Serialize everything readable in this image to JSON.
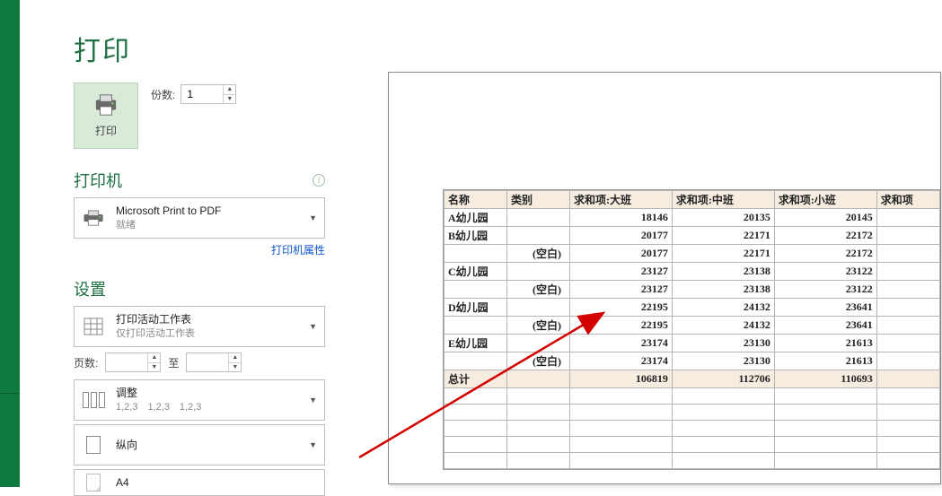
{
  "title": "打印",
  "printBtn": {
    "label": "打印"
  },
  "copies": {
    "label": "份数:",
    "value": "1"
  },
  "printerSection": {
    "title": "打印机",
    "name": "Microsoft Print to PDF",
    "status": "就绪",
    "propertiesLink": "打印机属性"
  },
  "settingsSection": {
    "title": "设置",
    "scope": {
      "line1": "打印活动工作表",
      "line2": "仅打印活动工作表"
    },
    "pages": {
      "label": "页数:",
      "to": "至"
    },
    "collate": {
      "line1": "调整",
      "line2": "1,2,3　1,2,3　1,2,3"
    },
    "orientation": {
      "line1": "纵向"
    },
    "paper": {
      "line1": "A4"
    }
  },
  "chart_data": {
    "type": "table",
    "columns": [
      "名称",
      "类别",
      "求和项:大班",
      "求和项:中班",
      "求和项:小班",
      "求和项"
    ],
    "rows": [
      [
        "A幼儿园",
        "",
        18146,
        20135,
        20145,
        null
      ],
      [
        "B幼儿园",
        "",
        20177,
        22171,
        22172,
        null
      ],
      [
        "",
        "(空白)",
        20177,
        22171,
        22172,
        null
      ],
      [
        "C幼儿园",
        "",
        23127,
        23138,
        23122,
        null
      ],
      [
        "",
        "(空白)",
        23127,
        23138,
        23122,
        null
      ],
      [
        "D幼儿园",
        "",
        22195,
        24132,
        23641,
        null
      ],
      [
        "",
        "(空白)",
        22195,
        24132,
        23641,
        null
      ],
      [
        "E幼儿园",
        "",
        23174,
        23130,
        21613,
        null
      ],
      [
        "",
        "(空白)",
        23174,
        23130,
        21613,
        null
      ]
    ],
    "totalRow": [
      "总计",
      "",
      106819,
      112706,
      110693,
      null
    ],
    "blank_trailing_rows": 5
  }
}
